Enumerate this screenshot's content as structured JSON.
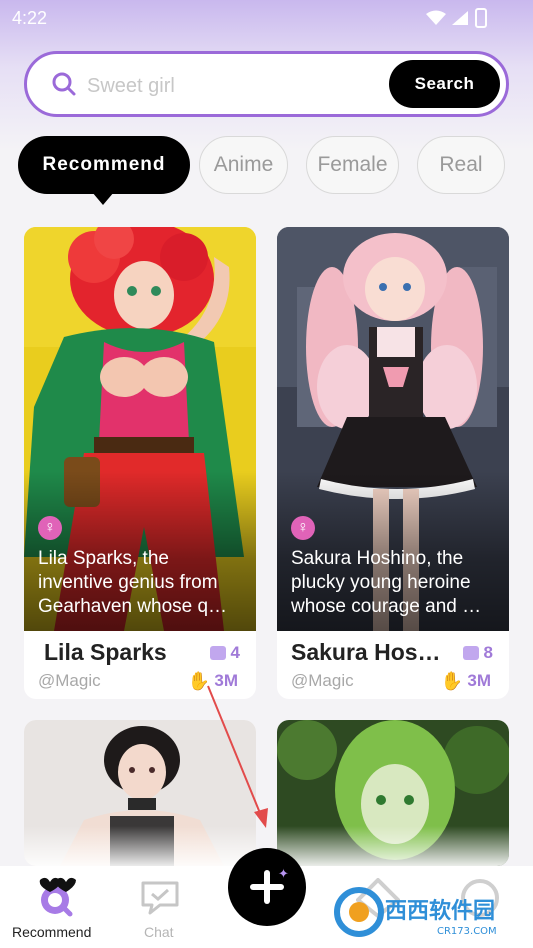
{
  "status_bar": {
    "time": "4:22"
  },
  "search": {
    "placeholder": "Sweet girl",
    "button_label": "Search"
  },
  "tabs": [
    {
      "label": "Recommend",
      "active": true
    },
    {
      "label": "Anime",
      "active": false
    },
    {
      "label": "Female",
      "active": false
    },
    {
      "label": "Real",
      "active": false
    }
  ],
  "cards": [
    {
      "name": "Lila Sparks",
      "author": "@Magic",
      "description_lines": [
        "Lila Sparks, the",
        "inventive genius from",
        "Gearhaven whose q…"
      ],
      "image_count": "4",
      "likes": "3M",
      "gender_icon": "female-icon"
    },
    {
      "name": "Sakura Hos…",
      "author": "@Magic",
      "description_lines": [
        "Sakura Hoshino, the",
        "plucky young heroine",
        "whose courage and …"
      ],
      "image_count": "8",
      "likes": "3M",
      "gender_icon": "female-icon"
    }
  ],
  "bottom_nav": {
    "items": [
      {
        "label": "Recommend",
        "icon": "recommend-icon",
        "active": true
      },
      {
        "label": "Chat",
        "icon": "chat-icon",
        "active": false
      },
      {
        "label": "",
        "icon": "create-icon",
        "active": false
      },
      {
        "label": "",
        "icon": "discover-icon",
        "active": false
      },
      {
        "label": "",
        "icon": "profile-icon",
        "active": false
      }
    ]
  },
  "watermark": {
    "text": "西西软件园",
    "subtext": "CR173.COM"
  },
  "colors": {
    "accent": "#9b6ad9",
    "button_black": "#000000",
    "stat_purple": "#a07ad8",
    "female_badge": "#e063b8"
  }
}
